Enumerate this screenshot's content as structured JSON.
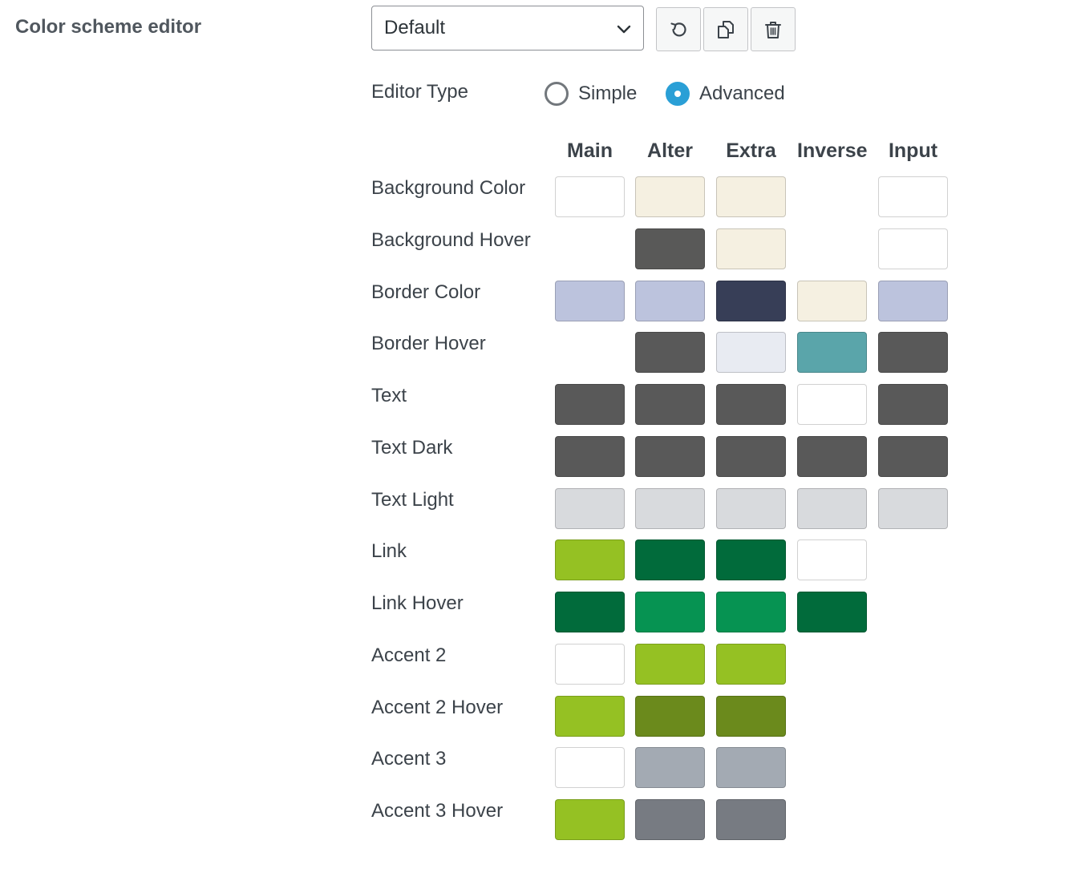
{
  "section_title": "Color scheme editor",
  "scheme_select": {
    "value": "Default"
  },
  "toolbar": [
    {
      "name": "reset-button",
      "icon": "reset-icon"
    },
    {
      "name": "copy-button",
      "icon": "copy-icon"
    },
    {
      "name": "delete-button",
      "icon": "trash-icon"
    }
  ],
  "editor_type": {
    "label": "Editor Type",
    "options": [
      {
        "label": "Simple",
        "selected": false
      },
      {
        "label": "Advanced",
        "selected": true
      }
    ]
  },
  "columns": [
    "Main",
    "Alter",
    "Extra",
    "Inverse",
    "Input"
  ],
  "rows": [
    {
      "label": "Background Color",
      "colors": [
        "#ffffff",
        "#f5f0e1",
        "#f5f0e1",
        null,
        "#ffffff"
      ]
    },
    {
      "label": "Background Hover",
      "colors": [
        null,
        "#595958",
        "#f5f0e1",
        null,
        "#ffffff"
      ]
    },
    {
      "label": "Border Color",
      "colors": [
        "#bcc3dd",
        "#bcc3dd",
        "#373e57",
        "#f5f0e1",
        "#bcc3dd"
      ]
    },
    {
      "label": "Border Hover",
      "colors": [
        null,
        "#595959",
        "#e8ebf2",
        "#5aa5aa",
        "#595959"
      ]
    },
    {
      "label": "Text",
      "colors": [
        "#595959",
        "#595959",
        "#595959",
        "#ffffff",
        "#595959"
      ]
    },
    {
      "label": "Text Dark",
      "colors": [
        "#595959",
        "#595959",
        "#595959",
        "#595959",
        "#595959"
      ]
    },
    {
      "label": "Text Light",
      "colors": [
        "#d8dadd",
        "#d8dadd",
        "#d8dadd",
        "#d8dadd",
        "#d8dadd"
      ]
    },
    {
      "label": "Link",
      "colors": [
        "#95c123",
        "#016b3b",
        "#016b3b",
        "#ffffff",
        null
      ]
    },
    {
      "label": "Link Hover",
      "colors": [
        "#016b3b",
        "#069352",
        "#069352",
        "#016b3b",
        null
      ]
    },
    {
      "label": "Accent 2",
      "colors": [
        "#ffffff",
        "#95c123",
        "#95c123",
        null,
        null
      ]
    },
    {
      "label": "Accent 2 Hover",
      "colors": [
        "#95c123",
        "#6b8a1c",
        "#6b8a1c",
        null,
        null
      ]
    },
    {
      "label": "Accent 3",
      "colors": [
        "#ffffff",
        "#a3aab3",
        "#a3aab3",
        null,
        null
      ]
    },
    {
      "label": "Accent 3 Hover",
      "colors": [
        "#95c123",
        "#777b82",
        "#777b82",
        null,
        null
      ]
    }
  ]
}
